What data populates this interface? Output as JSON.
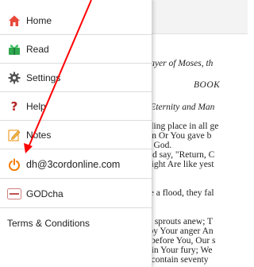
{
  "menu": {
    "items": [
      {
        "label": "Home",
        "icon": "home-icon"
      },
      {
        "label": "Read",
        "icon": "read-icon"
      },
      {
        "label": "Settings",
        "icon": "gear-icon"
      },
      {
        "label": "Help",
        "icon": "help-icon"
      },
      {
        "label": "Notes",
        "icon": "notes-icon"
      },
      {
        "label": "dh@3cordonline.com",
        "icon": "power-icon"
      },
      {
        "label": "GODcha",
        "icon": "godcha-logo-icon"
      },
      {
        "label": "Terms & Conditions",
        "icon": ""
      }
    ]
  },
  "reader": {
    "lines": [
      "A Prayer of Moses, th",
      "BOOK",
      "od's Eternity and Man",
      "dwelling place in all ge",
      "e born Or You gave b",
      "u are God.",
      "st And say, \"Return, C",
      "our sight Are like yest",
      "y like a flood, they fal",
      "s and sprouts anew; T",
      "hed by Your anger An",
      "ities before You, Our s",
      "ined in Your fury; We",
      "they contain seventy"
    ]
  },
  "colors": {
    "home_icon": "#e8493b",
    "read_icon": "#2fa84f",
    "help_icon": "#b22222",
    "power_icon": "#f57c00",
    "annotation_arrow": "#ff0000"
  }
}
